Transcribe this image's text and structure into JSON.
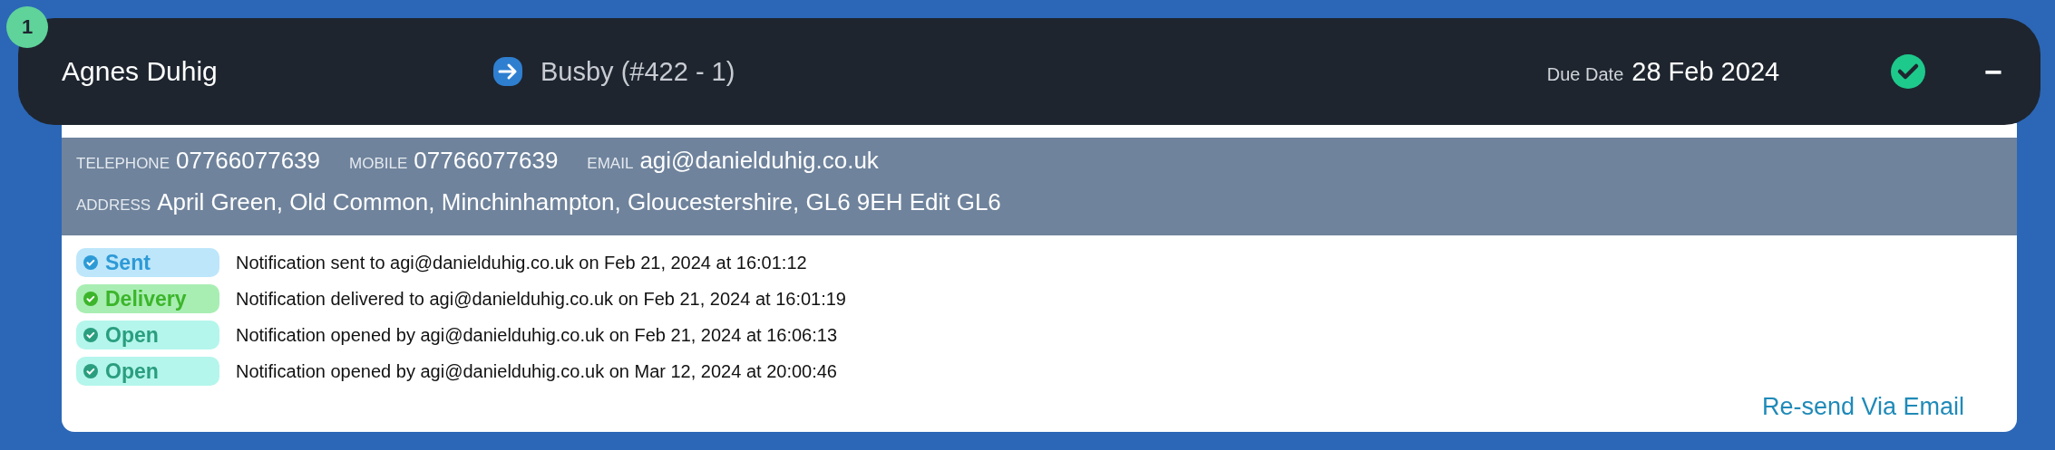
{
  "header": {
    "badge": "1",
    "name": "Agnes Duhig",
    "link": "Busby (#422 - 1)",
    "due_label": "Due Date",
    "due_date": "28 Feb 2024",
    "complete": true,
    "collapse": "−"
  },
  "contact": {
    "fields": [
      {
        "label": "TELEPHONE",
        "value": "07766077639"
      },
      {
        "label": "MOBILE",
        "value": "07766077639"
      },
      {
        "label": "EMAIL",
        "value": "agi@danielduhig.co.uk"
      }
    ],
    "address": {
      "label": "ADDRESS",
      "value": "April Green, Old Common, Minchinhampton, Gloucestershire, GL6 9EH Edit GL6"
    }
  },
  "events": [
    {
      "kind": "sent",
      "status": "Sent",
      "text": "Notification sent to agi@danielduhig.co.uk on Feb 21, 2024 at 16:01:12"
    },
    {
      "kind": "delivery",
      "status": "Delivery",
      "text": "Notification delivered to agi@danielduhig.co.uk on Feb 21, 2024 at 16:01:19"
    },
    {
      "kind": "open",
      "status": "Open",
      "text": "Notification opened by agi@danielduhig.co.uk on Feb 21, 2024 at 16:06:13"
    },
    {
      "kind": "open",
      "status": "Open",
      "text": "Notification opened by agi@danielduhig.co.uk on Mar 12, 2024 at 20:00:46"
    }
  ],
  "resend": "Re-send Via Email"
}
